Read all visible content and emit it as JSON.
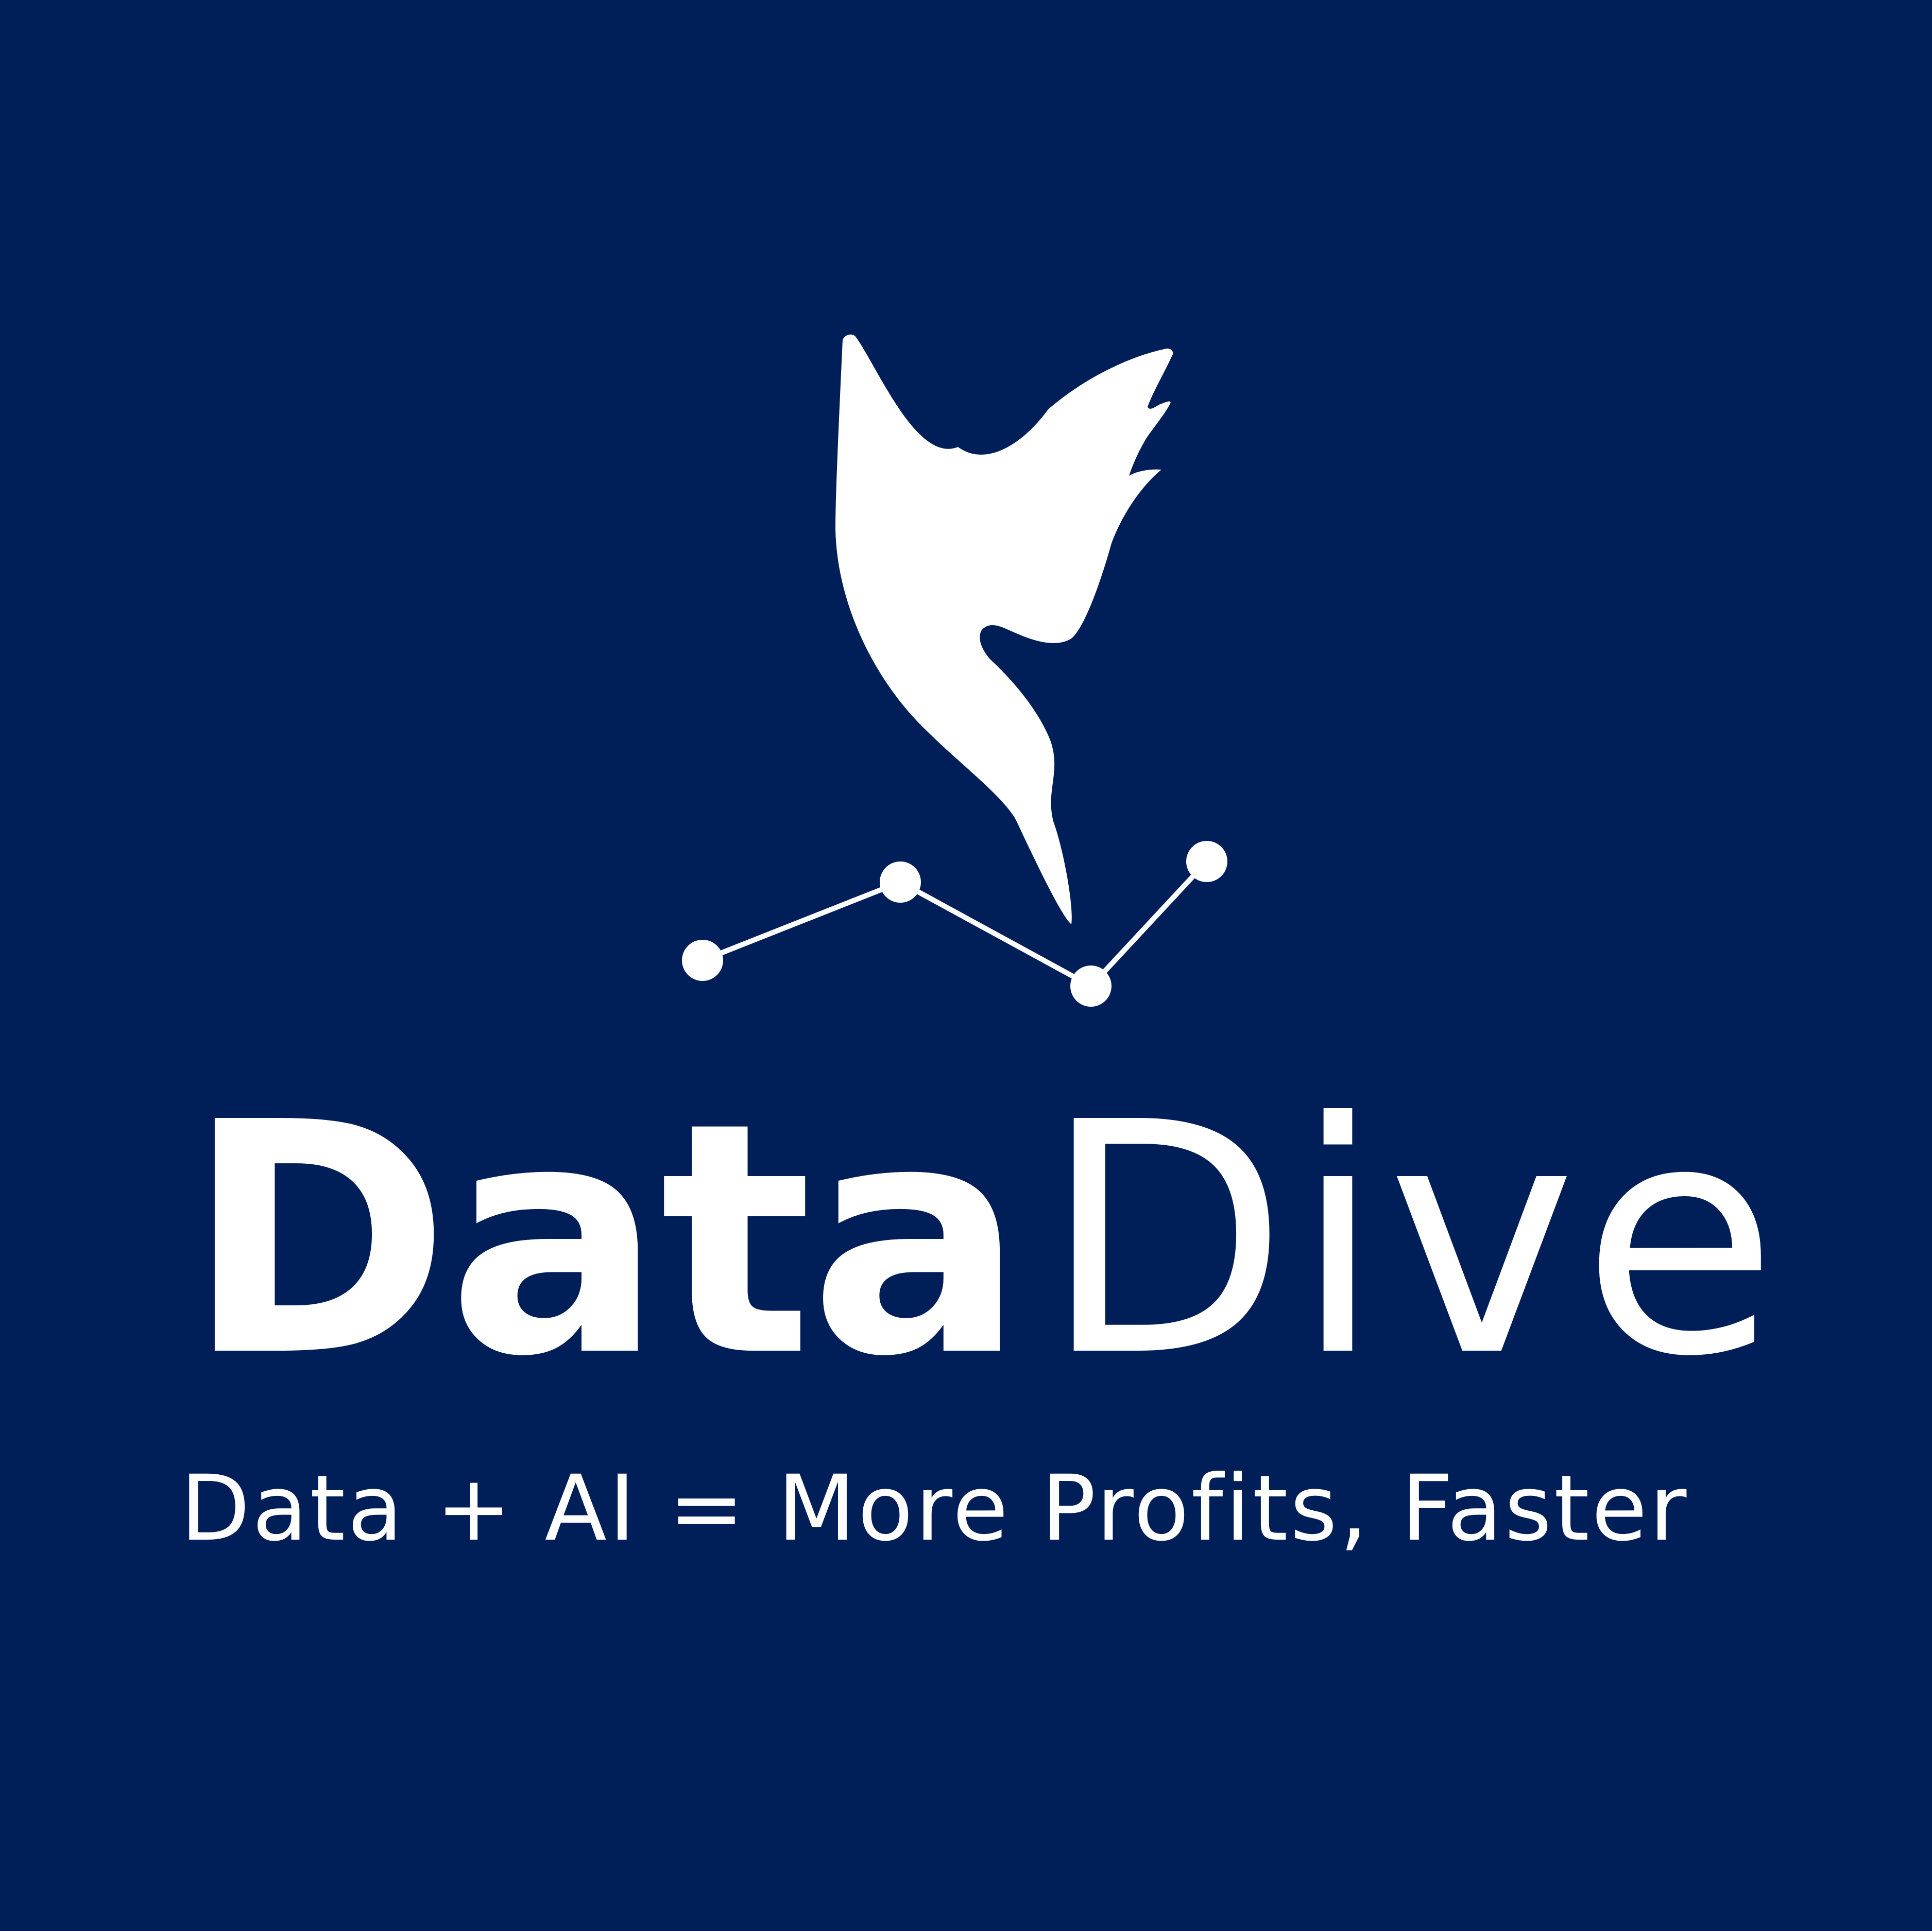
{
  "logo": {
    "brand_bold": "Data",
    "brand_light": "Dive",
    "tagline": "Data + AI = More Profits, Faster",
    "icon": "bird-diving-over-line-chart-icon"
  },
  "colors": {
    "background": "#001f59",
    "foreground": "#ffffff"
  }
}
